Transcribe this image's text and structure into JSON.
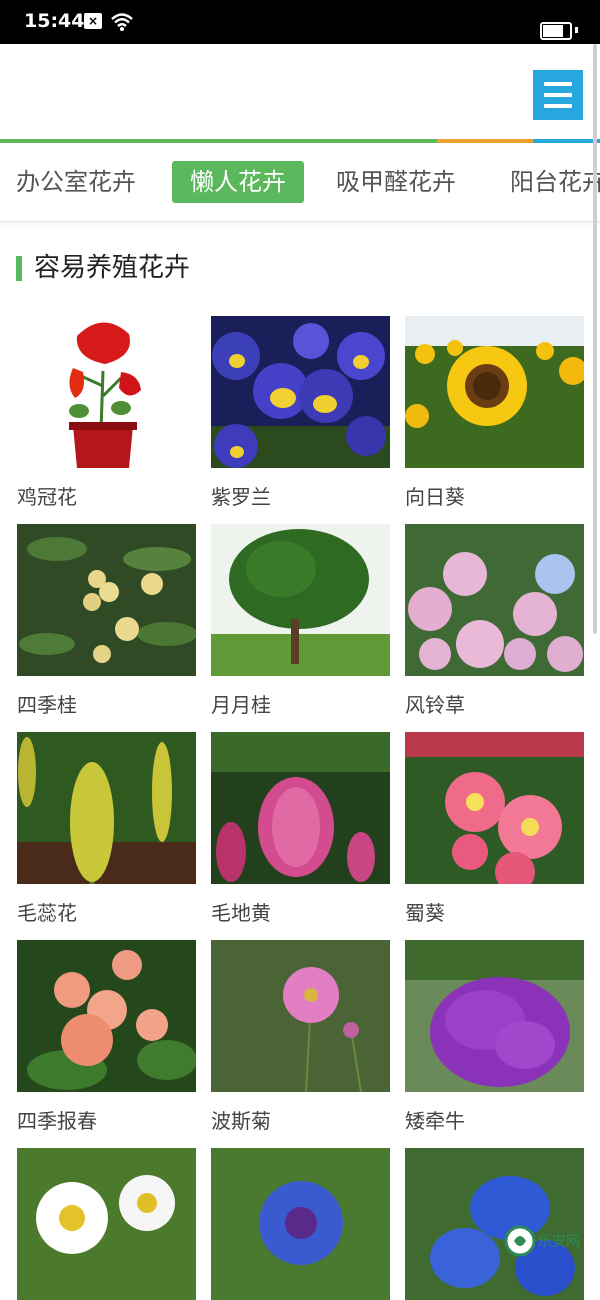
{
  "status_bar": {
    "time": "15:44",
    "sim_icon": "sim-x-icon",
    "wifi_icon": "wifi-icon",
    "battery_level": 0.75
  },
  "header": {
    "menu_icon": "menu-icon",
    "menu_color": "#26a7de"
  },
  "accent_colors": [
    "#5cb85c",
    "#f0a030",
    "#26a7de"
  ],
  "tabs": [
    {
      "label": "办公室花卉",
      "active": false
    },
    {
      "label": "懒人花卉",
      "active": true
    },
    {
      "label": "吸甲醛花卉",
      "active": false
    },
    {
      "label": "阳台花卉",
      "active": false
    }
  ],
  "section": {
    "title": "容易养殖花卉"
  },
  "flowers": [
    {
      "name": "鸡冠花",
      "image": "cockscomb-pot"
    },
    {
      "name": "紫罗兰",
      "image": "pansy"
    },
    {
      "name": "向日葵",
      "image": "sunflower"
    },
    {
      "name": "四季桂",
      "image": "osmanthus"
    },
    {
      "name": "月月桂",
      "image": "laurel-tree"
    },
    {
      "name": "风铃草",
      "image": "bellflower"
    },
    {
      "name": "毛蕊花",
      "image": "mullein"
    },
    {
      "name": "毛地黄",
      "image": "foxglove"
    },
    {
      "name": "蜀葵",
      "image": "hollyhock"
    },
    {
      "name": "四季报春",
      "image": "primrose"
    },
    {
      "name": "波斯菊",
      "image": "cosmos"
    },
    {
      "name": "矮牵牛",
      "image": "petunia"
    },
    {
      "name": "",
      "image": "daisy"
    },
    {
      "name": "",
      "image": "cornflower"
    },
    {
      "name": "",
      "image": "delphinium"
    }
  ],
  "watermark": {
    "text": "乐安网"
  }
}
